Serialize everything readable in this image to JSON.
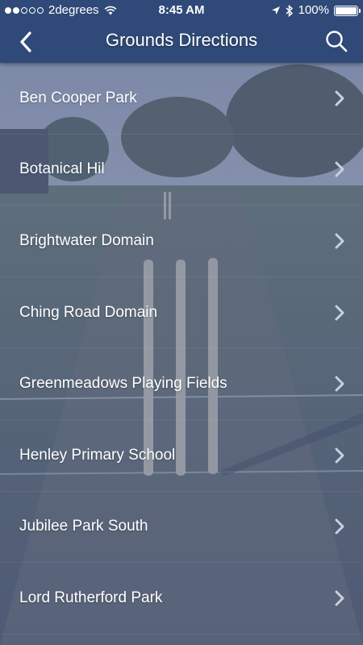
{
  "status_bar": {
    "carrier": "2degrees",
    "time": "8:45 AM",
    "battery": "100%",
    "icons": [
      "signal-dots-icon",
      "wifi-icon",
      "location-arrow-icon",
      "bluetooth-icon",
      "battery-icon"
    ]
  },
  "navbar": {
    "title": "Grounds Directions",
    "back_icon": "chevron-left-icon",
    "search_icon": "search-icon"
  },
  "colors": {
    "navbar_bg": "#2f4a78",
    "overlay": "#5c6c91",
    "text": "#ffffff",
    "chevron": "#c9d0df"
  },
  "grounds": [
    {
      "label": "Ben Cooper Park"
    },
    {
      "label": "Botanical Hil"
    },
    {
      "label": "Brightwater Domain"
    },
    {
      "label": "Ching Road Domain"
    },
    {
      "label": "Greenmeadows Playing Fields"
    },
    {
      "label": "Henley Primary School"
    },
    {
      "label": "Jubilee Park South"
    },
    {
      "label": "Lord Rutherford Park"
    }
  ]
}
